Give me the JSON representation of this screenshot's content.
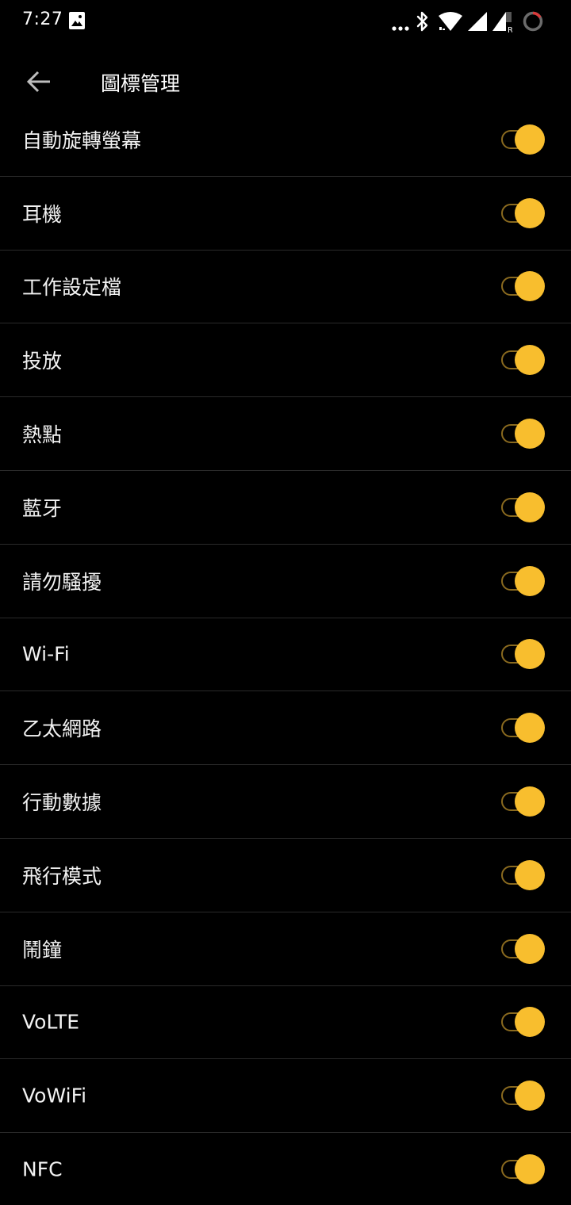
{
  "status_bar": {
    "time": "7:27",
    "left_icons": [
      "image-icon"
    ],
    "right_icons": [
      "more-dots-icon",
      "bluetooth-icon",
      "wifi-icon",
      "signal-icon",
      "signal-roaming-icon",
      "battery-ring-icon"
    ],
    "roaming_mark": "R"
  },
  "app_bar": {
    "back_icon": "arrow-back-icon",
    "title": "圖標管理"
  },
  "colors": {
    "background": "#000000",
    "accent": "#f8be2e",
    "track": "#8a6a1f",
    "divider": "#2a2a2a",
    "battery_ring": "#d93a3a"
  },
  "items": [
    {
      "label": "自動旋轉螢幕",
      "enabled": true
    },
    {
      "label": "耳機",
      "enabled": true
    },
    {
      "label": "工作設定檔",
      "enabled": true
    },
    {
      "label": "投放",
      "enabled": true
    },
    {
      "label": "熱點",
      "enabled": true
    },
    {
      "label": "藍牙",
      "enabled": true
    },
    {
      "label": "請勿騷擾",
      "enabled": true
    },
    {
      "label": "Wi-Fi",
      "enabled": true
    },
    {
      "label": "乙太網路",
      "enabled": true
    },
    {
      "label": "行動數據",
      "enabled": true
    },
    {
      "label": "飛行模式",
      "enabled": true
    },
    {
      "label": "鬧鐘",
      "enabled": true
    },
    {
      "label": "VoLTE",
      "enabled": true
    },
    {
      "label": "VoWiFi",
      "enabled": true
    },
    {
      "label": "NFC",
      "enabled": true
    }
  ]
}
